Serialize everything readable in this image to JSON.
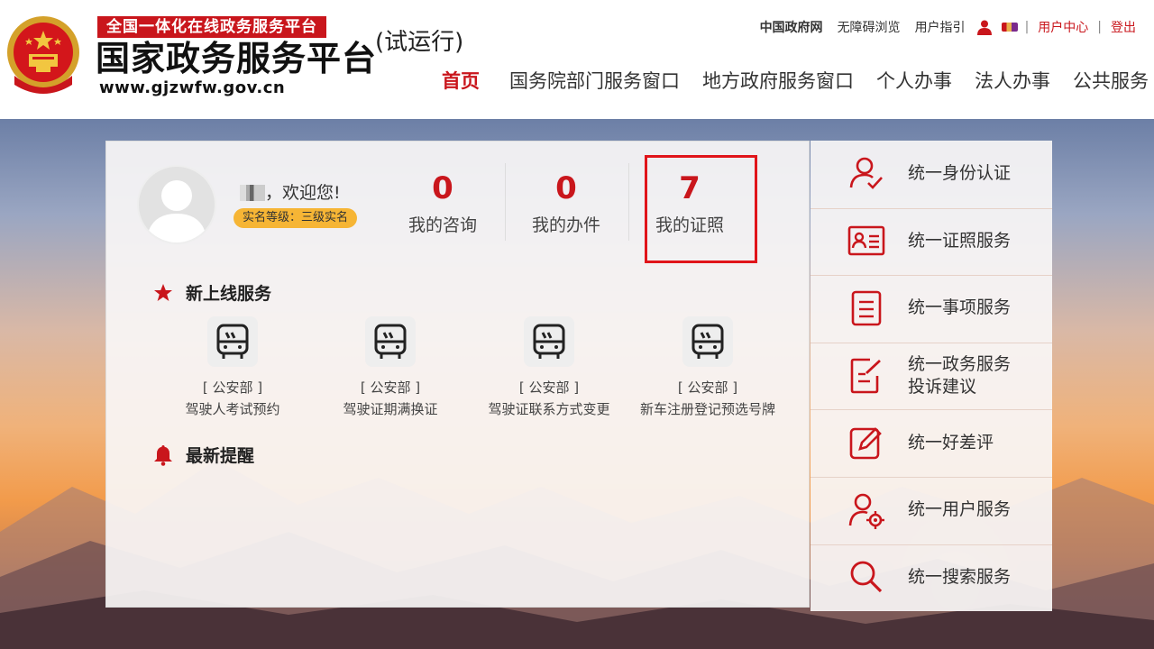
{
  "header": {
    "tagline": "全国一体化在线政务服务平台",
    "site_name": "国家政务服务平台",
    "site_url": "www.gjzwfw.gov.cn",
    "trial": "(试运行)",
    "top_links": [
      "中国政府网",
      "无障碍浏览",
      "用户指引"
    ],
    "user_center": "用户中心",
    "logout": "登出",
    "nav": [
      "首页",
      "国务院部门服务窗口",
      "地方政府服务窗口",
      "个人办事",
      "法人办事",
      "公共服务"
    ]
  },
  "user": {
    "welcome": "，欢迎您!",
    "level": "实名等级：三级实名"
  },
  "stats": [
    {
      "value": "0",
      "label": "我的咨询"
    },
    {
      "value": "0",
      "label": "我的办件"
    },
    {
      "value": "7",
      "label": "我的证照"
    }
  ],
  "new_services": {
    "title": "新上线服务",
    "items": [
      {
        "dept": "[ 公安部 ]",
        "name": "驾驶人考试预约",
        "icon": "bus-icon"
      },
      {
        "dept": "[ 公安部 ]",
        "name": "驾驶证期满换证",
        "icon": "bus-icon"
      },
      {
        "dept": "[ 公安部 ]",
        "name": "驾驶证联系方式变更",
        "icon": "bus-icon"
      },
      {
        "dept": "[ 公安部 ]",
        "name": "新车注册登记预选号牌",
        "icon": "bus-icon"
      }
    ]
  },
  "reminders": {
    "title": "最新提醒"
  },
  "right_menu": [
    {
      "label": "统一身份认证",
      "icon": "identity-icon"
    },
    {
      "label": "统一证照服务",
      "icon": "id-card-icon"
    },
    {
      "label": "统一事项服务",
      "icon": "document-icon"
    },
    {
      "label": "统一政务服务\n投诉建议",
      "icon": "edit-document-icon"
    },
    {
      "label": "统一好差评",
      "icon": "pencil-icon"
    },
    {
      "label": "统一用户服务",
      "icon": "user-settings-icon"
    },
    {
      "label": "统一搜索服务",
      "icon": "search-icon"
    }
  ],
  "colors": {
    "brand_red": "#c9161c",
    "badge_yellow": "#f6b535"
  }
}
